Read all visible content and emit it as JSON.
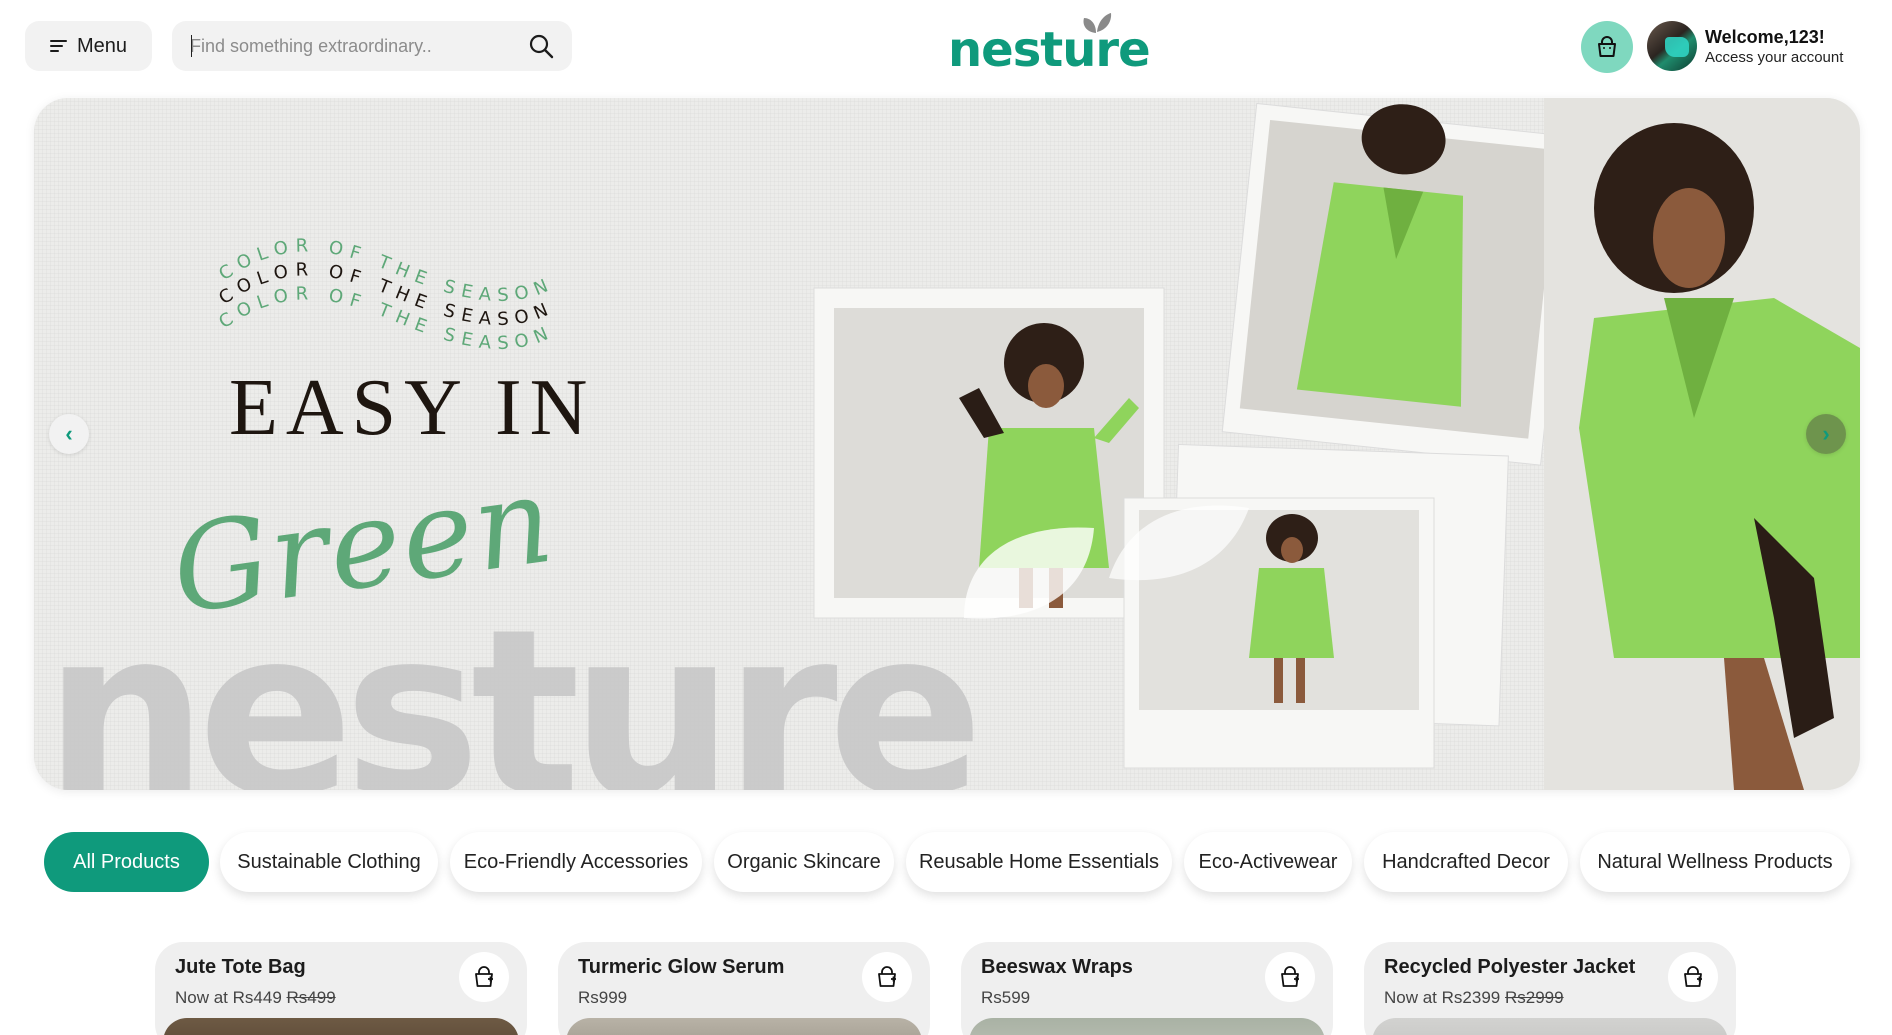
{
  "header": {
    "menu_label": "Menu",
    "search_placeholder": "Find something extraordinary..",
    "logo_text": "nesture",
    "welcome_title": "Welcome,123!",
    "welcome_subtitle": "Access your account"
  },
  "hero": {
    "wave_text": "COLOR OF THE SEASON",
    "headline": "EASY IN",
    "script_word": "Green",
    "watermark": "nesture",
    "prev_icon": "chevron-left-icon",
    "next_icon": "chevron-right-icon"
  },
  "categories": [
    {
      "label": "All Products",
      "active": true
    },
    {
      "label": "Sustainable Clothing",
      "active": false
    },
    {
      "label": "Eco-Friendly Accessories",
      "active": false
    },
    {
      "label": "Organic Skincare",
      "active": false
    },
    {
      "label": "Reusable Home Essentials",
      "active": false
    },
    {
      "label": "Eco-Activewear",
      "active": false
    },
    {
      "label": "Handcrafted Decor",
      "active": false
    },
    {
      "label": "Natural Wellness Products",
      "active": false
    }
  ],
  "products": [
    {
      "name": "Jute Tote Bag",
      "price_prefix": "Now at",
      "price": "Rs449",
      "old_price": "Rs499"
    },
    {
      "name": "Turmeric Glow Serum",
      "price_prefix": "",
      "price": "Rs999",
      "old_price": ""
    },
    {
      "name": "Beeswax Wraps",
      "price_prefix": "",
      "price": "Rs599",
      "old_price": ""
    },
    {
      "name": "Recycled Polyester Jacket",
      "price_prefix": "Now at",
      "price": "Rs2399",
      "old_price": "Rs2999"
    }
  ],
  "colors": {
    "brand": "#0f9a7c",
    "cart_button": "#7fd8bf",
    "script_green": "#5ea878",
    "jacket_green": "#8fd45c"
  }
}
